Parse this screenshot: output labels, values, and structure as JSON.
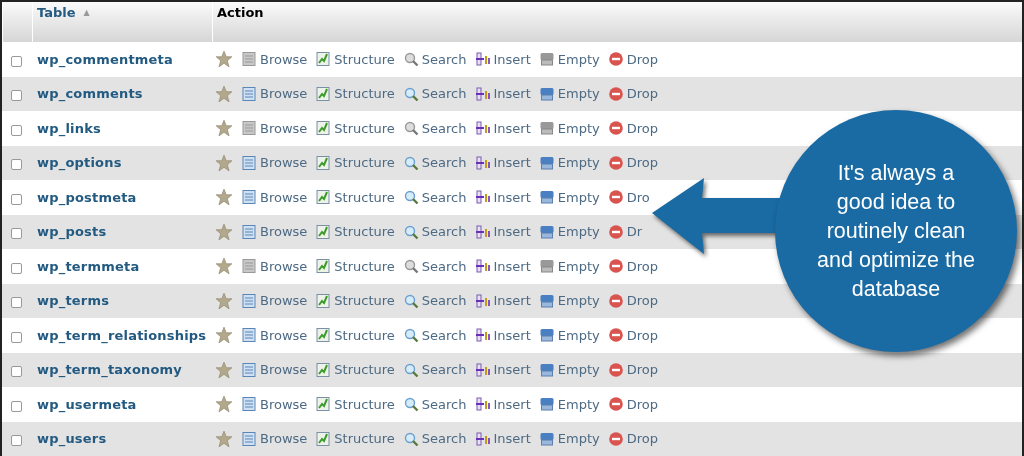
{
  "table": {
    "columns": [
      {
        "label": "Table",
        "sort_indicator": "▲"
      },
      {
        "label": "Action"
      }
    ],
    "rows": [
      {
        "name": "wp_commentmeta",
        "checked": false,
        "empty": true,
        "actions": [
          {
            "kind": "favorite"
          },
          {
            "kind": "browse",
            "label": "Browse"
          },
          {
            "kind": "structure",
            "label": "Structure"
          },
          {
            "kind": "search",
            "label": "Search"
          },
          {
            "kind": "insert",
            "label": "Insert"
          },
          {
            "kind": "empty",
            "label": "Empty"
          },
          {
            "kind": "drop",
            "label": "Drop"
          }
        ]
      },
      {
        "name": "wp_comments",
        "checked": false,
        "empty": false,
        "actions": [
          {
            "kind": "favorite"
          },
          {
            "kind": "browse",
            "label": "Browse"
          },
          {
            "kind": "structure",
            "label": "Structure"
          },
          {
            "kind": "search",
            "label": "Search"
          },
          {
            "kind": "insert",
            "label": "Insert"
          },
          {
            "kind": "empty",
            "label": "Empty"
          },
          {
            "kind": "drop",
            "label": "Drop"
          }
        ]
      },
      {
        "name": "wp_links",
        "checked": false,
        "empty": true,
        "actions": [
          {
            "kind": "favorite"
          },
          {
            "kind": "browse",
            "label": "Browse"
          },
          {
            "kind": "structure",
            "label": "Structure"
          },
          {
            "kind": "search",
            "label": "Search"
          },
          {
            "kind": "insert",
            "label": "Insert"
          },
          {
            "kind": "empty",
            "label": "Empty"
          },
          {
            "kind": "drop",
            "label": "Drop"
          }
        ]
      },
      {
        "name": "wp_options",
        "checked": false,
        "empty": false,
        "actions": [
          {
            "kind": "favorite"
          },
          {
            "kind": "browse",
            "label": "Browse"
          },
          {
            "kind": "structure",
            "label": "Structure"
          },
          {
            "kind": "search",
            "label": "Search"
          },
          {
            "kind": "insert",
            "label": "Insert"
          },
          {
            "kind": "empty",
            "label": "Empty"
          },
          {
            "kind": "drop",
            "label": "Drop"
          }
        ]
      },
      {
        "name": "wp_postmeta",
        "checked": false,
        "empty": false,
        "actions": [
          {
            "kind": "favorite"
          },
          {
            "kind": "browse",
            "label": "Browse"
          },
          {
            "kind": "structure",
            "label": "Structure"
          },
          {
            "kind": "search",
            "label": "Search"
          },
          {
            "kind": "insert",
            "label": "Insert"
          },
          {
            "kind": "empty",
            "label": "Empty"
          },
          {
            "kind": "drop",
            "label": "Dro"
          }
        ]
      },
      {
        "name": "wp_posts",
        "checked": false,
        "empty": false,
        "actions": [
          {
            "kind": "favorite"
          },
          {
            "kind": "browse",
            "label": "Browse"
          },
          {
            "kind": "structure",
            "label": "Structure"
          },
          {
            "kind": "search",
            "label": "Search"
          },
          {
            "kind": "insert",
            "label": "Insert"
          },
          {
            "kind": "empty",
            "label": "Empty"
          },
          {
            "kind": "drop",
            "label": "Dr"
          }
        ]
      },
      {
        "name": "wp_termmeta",
        "checked": false,
        "empty": true,
        "actions": [
          {
            "kind": "favorite"
          },
          {
            "kind": "browse",
            "label": "Browse"
          },
          {
            "kind": "structure",
            "label": "Structure"
          },
          {
            "kind": "search",
            "label": "Search"
          },
          {
            "kind": "insert",
            "label": "Insert"
          },
          {
            "kind": "empty",
            "label": "Empty"
          },
          {
            "kind": "drop",
            "label": "Drop"
          }
        ]
      },
      {
        "name": "wp_terms",
        "checked": false,
        "empty": false,
        "actions": [
          {
            "kind": "favorite"
          },
          {
            "kind": "browse",
            "label": "Browse"
          },
          {
            "kind": "structure",
            "label": "Structure"
          },
          {
            "kind": "search",
            "label": "Search"
          },
          {
            "kind": "insert",
            "label": "Insert"
          },
          {
            "kind": "empty",
            "label": "Empty"
          },
          {
            "kind": "drop",
            "label": "Drop"
          }
        ]
      },
      {
        "name": "wp_term_relationships",
        "checked": false,
        "empty": false,
        "actions": [
          {
            "kind": "favorite"
          },
          {
            "kind": "browse",
            "label": "Browse"
          },
          {
            "kind": "structure",
            "label": "Structure"
          },
          {
            "kind": "search",
            "label": "Search"
          },
          {
            "kind": "insert",
            "label": "Insert"
          },
          {
            "kind": "empty",
            "label": "Empty"
          },
          {
            "kind": "drop",
            "label": "Drop"
          }
        ]
      },
      {
        "name": "wp_term_taxonomy",
        "checked": false,
        "empty": false,
        "actions": [
          {
            "kind": "favorite"
          },
          {
            "kind": "browse",
            "label": "Browse"
          },
          {
            "kind": "structure",
            "label": "Structure"
          },
          {
            "kind": "search",
            "label": "Search"
          },
          {
            "kind": "insert",
            "label": "Insert"
          },
          {
            "kind": "empty",
            "label": "Empty"
          },
          {
            "kind": "drop",
            "label": "Drop"
          }
        ]
      },
      {
        "name": "wp_usermeta",
        "checked": false,
        "empty": false,
        "actions": [
          {
            "kind": "favorite"
          },
          {
            "kind": "browse",
            "label": "Browse"
          },
          {
            "kind": "structure",
            "label": "Structure"
          },
          {
            "kind": "search",
            "label": "Search"
          },
          {
            "kind": "insert",
            "label": "Insert"
          },
          {
            "kind": "empty",
            "label": "Empty"
          },
          {
            "kind": "drop",
            "label": "Drop"
          }
        ]
      },
      {
        "name": "wp_users",
        "checked": false,
        "empty": false,
        "actions": [
          {
            "kind": "favorite"
          },
          {
            "kind": "browse",
            "label": "Browse"
          },
          {
            "kind": "structure",
            "label": "Structure"
          },
          {
            "kind": "search",
            "label": "Search"
          },
          {
            "kind": "insert",
            "label": "Insert"
          },
          {
            "kind": "empty",
            "label": "Empty"
          },
          {
            "kind": "drop",
            "label": "Drop"
          }
        ]
      }
    ]
  },
  "callout": {
    "lines": [
      "It's always a",
      "good idea to",
      "routinely clean",
      "and optimize the",
      "database"
    ]
  }
}
